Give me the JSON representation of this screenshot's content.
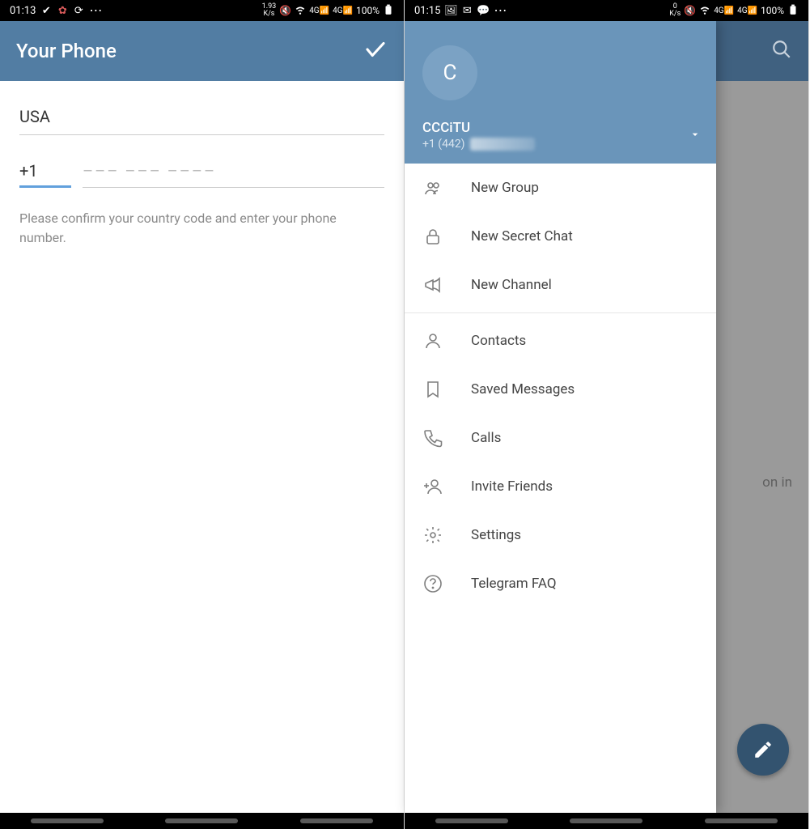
{
  "left": {
    "status": {
      "time": "01:13",
      "speed_value": "1.93",
      "speed_unit": "K/s",
      "net_label": "4G",
      "battery": "100%"
    },
    "appbar": {
      "title": "Your Phone"
    },
    "form": {
      "country": "USA",
      "country_code": "+1",
      "placeholder": "––– ––– ––––",
      "hint": "Please confirm your country code and enter your phone number."
    }
  },
  "right": {
    "status": {
      "time": "01:15",
      "speed_value": "0",
      "speed_unit": "K/s",
      "net_label": "4G",
      "battery": "100%"
    },
    "bg": {
      "hint_fragment": "on in"
    },
    "drawer": {
      "avatar_letter": "C",
      "name": "CCCiTU",
      "phone": "+1 (442)",
      "groups": [
        [
          {
            "key": "new-group",
            "label": "New Group",
            "icon": "group-icon"
          },
          {
            "key": "new-secret-chat",
            "label": "New Secret Chat",
            "icon": "lock-icon"
          },
          {
            "key": "new-channel",
            "label": "New Channel",
            "icon": "megaphone-icon"
          }
        ],
        [
          {
            "key": "contacts",
            "label": "Contacts",
            "icon": "person-icon"
          },
          {
            "key": "saved-messages",
            "label": "Saved Messages",
            "icon": "bookmark-icon"
          },
          {
            "key": "calls",
            "label": "Calls",
            "icon": "phone-icon"
          },
          {
            "key": "invite-friends",
            "label": "Invite Friends",
            "icon": "person-add-icon"
          },
          {
            "key": "settings",
            "label": "Settings",
            "icon": "gear-icon"
          },
          {
            "key": "telegram-faq",
            "label": "Telegram FAQ",
            "icon": "help-icon"
          }
        ]
      ]
    }
  }
}
